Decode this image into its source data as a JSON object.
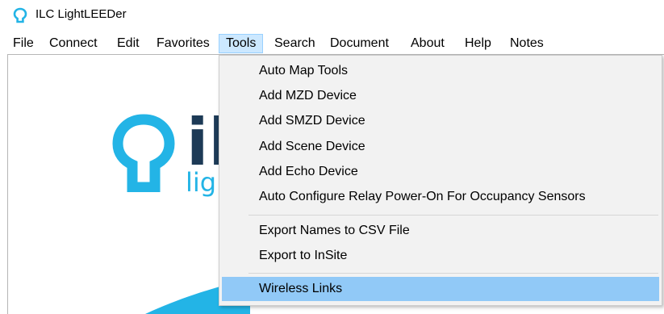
{
  "window": {
    "title": "ILC LightLEEDer",
    "icon": "lightbulb-outline-icon"
  },
  "menubar": {
    "items": [
      "File",
      "Connect",
      "Edit",
      "Favorites",
      "Tools",
      "Search",
      "Document",
      "About",
      "Help",
      "Notes"
    ],
    "open_menu": "Tools"
  },
  "tools_menu": {
    "items": [
      "Auto Map Tools",
      "Add MZD Device",
      "Add SMZD Device",
      "Add Scene Device",
      "Add Echo Device",
      "Auto Configure Relay Power-On For Occupancy Sensors",
      "Export Names to CSV File",
      "Export to InSite",
      "Wireless Links"
    ],
    "highlighted": "Wireless Links"
  },
  "logo": {
    "word": "il",
    "subtext": "ligh"
  },
  "colors": {
    "brand_blue": "#23b4e6",
    "brand_navy": "#1d3a56",
    "menu_open_bg": "#cce8ff",
    "menu_highlight_bg": "#91c9f7",
    "dropdown_bg": "#f2f2f2"
  }
}
